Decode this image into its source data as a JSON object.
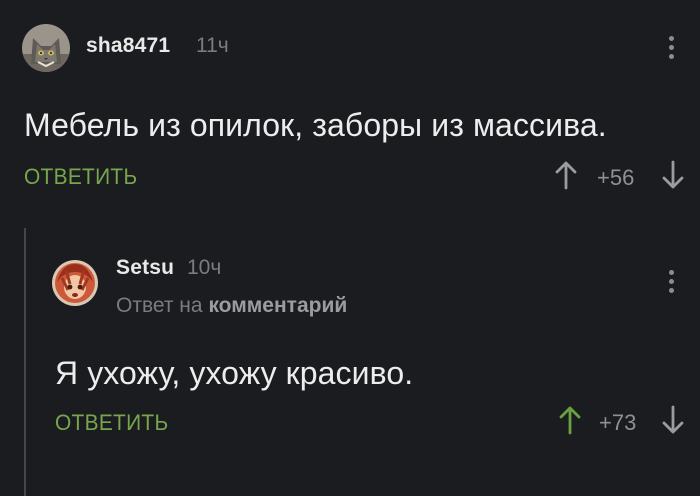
{
  "comment1": {
    "username": "sha8471",
    "time": "11ч",
    "text": "Мебель из опилок, заборы из массива.",
    "reply_label": "ОТВЕТИТЬ",
    "rating": "+56"
  },
  "comment2": {
    "username": "Setsu",
    "time": "10ч",
    "reply_to_prefix": "Ответ на",
    "reply_to_target": "комментарий",
    "text": "Я ухожу, ухожу красиво.",
    "reply_label": "ОТВЕТИТЬ",
    "rating": "+73"
  },
  "colors": {
    "background": "#1b1c1f",
    "accent_green": "#77a64d",
    "upvoted": "#6aa13f",
    "muted": "#8e9094"
  },
  "icons": [
    "cat-avatar",
    "anime-avatar",
    "more-dots-icon",
    "arrow-up-icon",
    "arrow-down-icon"
  ]
}
